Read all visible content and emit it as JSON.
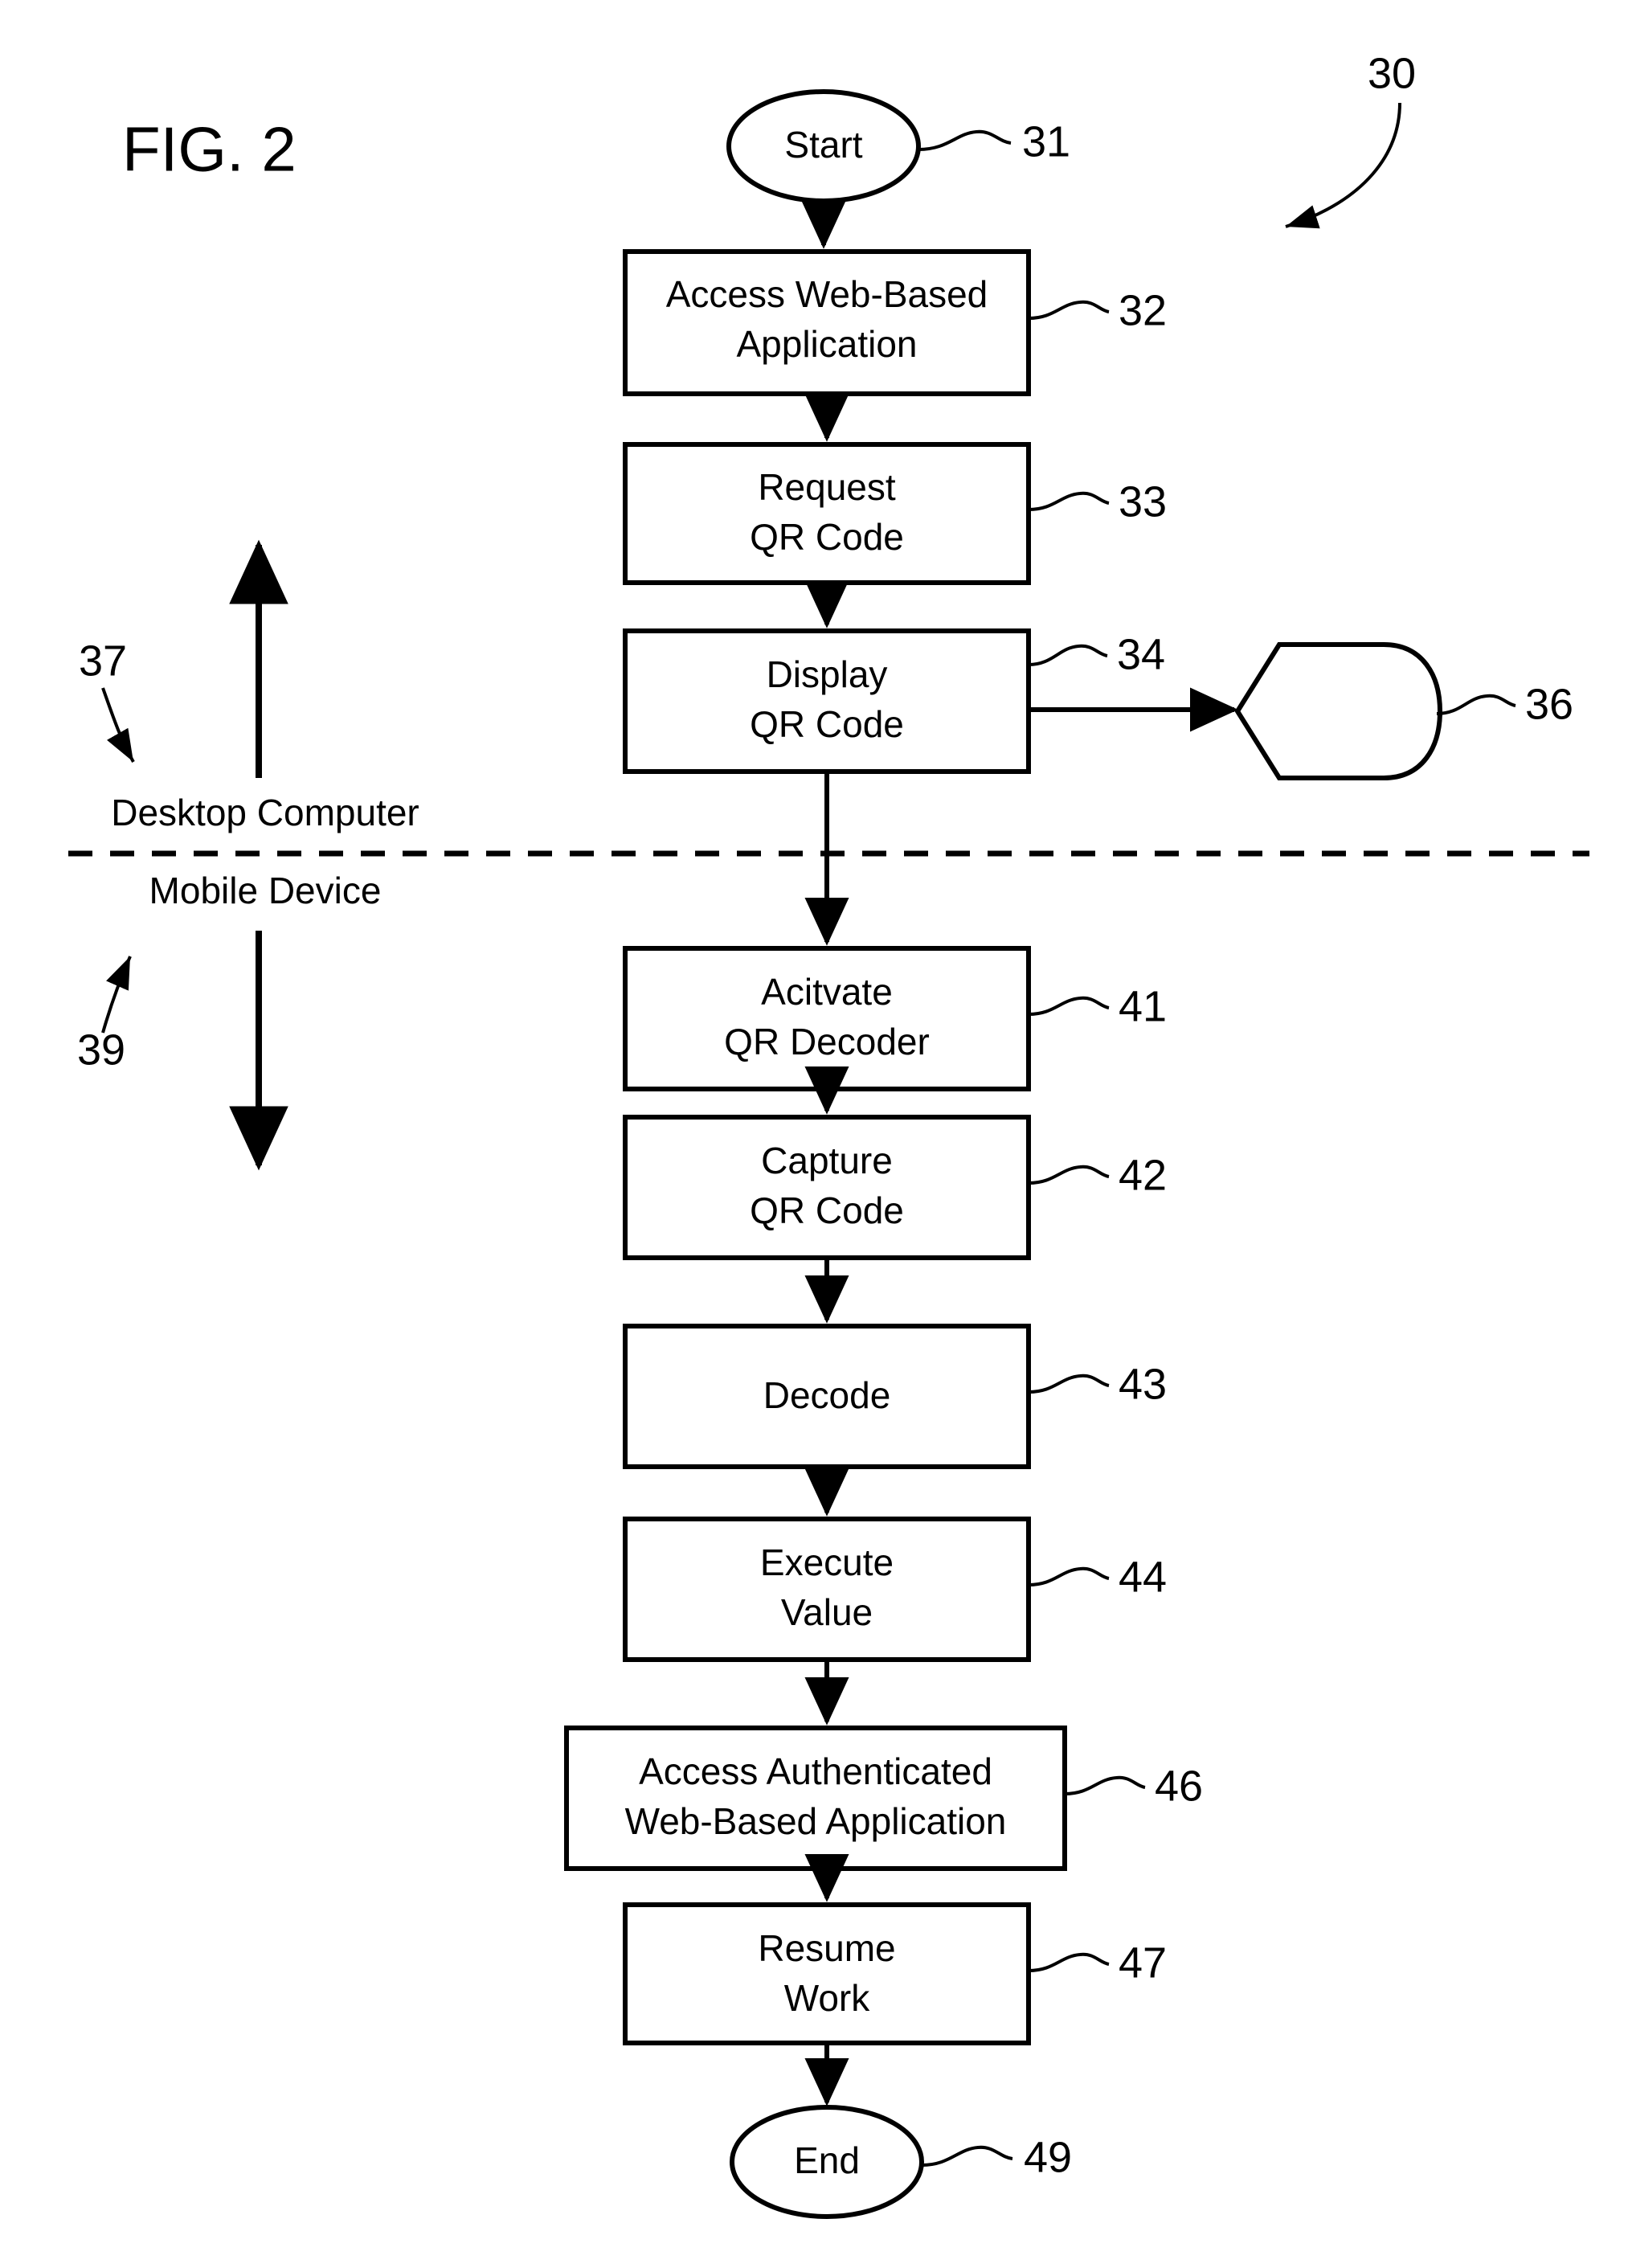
{
  "figure": {
    "title": "FIG. 2",
    "overall_ref": "30"
  },
  "lanes": {
    "top_label": "Desktop Computer",
    "top_ref": "37",
    "bottom_label": "Mobile Device",
    "bottom_ref": "39"
  },
  "nodes": [
    {
      "id": "start",
      "shape": "ellipse",
      "lines": [
        "Start"
      ],
      "ref": "31"
    },
    {
      "id": "n32",
      "shape": "process",
      "lines": [
        "Access Web-Based",
        "Application"
      ],
      "ref": "32"
    },
    {
      "id": "n33",
      "shape": "process",
      "lines": [
        "Request",
        "QR Code"
      ],
      "ref": "33"
    },
    {
      "id": "n34",
      "shape": "process",
      "lines": [
        "Display",
        "QR Code"
      ],
      "ref": "34"
    },
    {
      "id": "n36",
      "shape": "display",
      "lines": [],
      "ref": "36"
    },
    {
      "id": "n41",
      "shape": "process",
      "lines": [
        "Acitvate",
        "QR Decoder"
      ],
      "ref": "41"
    },
    {
      "id": "n42",
      "shape": "process",
      "lines": [
        "Capture",
        "QR Code"
      ],
      "ref": "42"
    },
    {
      "id": "n43",
      "shape": "process",
      "lines": [
        "Decode"
      ],
      "ref": "43"
    },
    {
      "id": "n44",
      "shape": "process",
      "lines": [
        "Execute",
        "Value"
      ],
      "ref": "44"
    },
    {
      "id": "n46",
      "shape": "process",
      "lines": [
        "Access Authenticated",
        "Web-Based Application"
      ],
      "ref": "46"
    },
    {
      "id": "n47",
      "shape": "process",
      "lines": [
        "Resume",
        "Work"
      ],
      "ref": "47"
    },
    {
      "id": "end",
      "shape": "ellipse",
      "lines": [
        "End"
      ],
      "ref": "49"
    }
  ],
  "text": {
    "start_label": "Start",
    "end_label": "End",
    "n32_l1": "Access Web-Based",
    "n32_l2": "Application",
    "n33_l1": "Request",
    "n33_l2": "QR Code",
    "n34_l1": "Display",
    "n34_l2": "QR Code",
    "n41_l1": "Acitvate",
    "n41_l2": "QR Decoder",
    "n42_l1": "Capture",
    "n42_l2": "QR Code",
    "n43_l1": "Decode",
    "n44_l1": "Execute",
    "n44_l2": "Value",
    "n46_l1": "Access Authenticated",
    "n46_l2": "Web-Based Application",
    "n47_l1": "Resume",
    "n47_l2": "Work"
  },
  "refs": {
    "r30": "30",
    "r31": "31",
    "r32": "32",
    "r33": "33",
    "r34": "34",
    "r36": "36",
    "r37": "37",
    "r39": "39",
    "r41": "41",
    "r42": "42",
    "r43": "43",
    "r44": "44",
    "r46": "46",
    "r47": "47",
    "r49": "49"
  },
  "colors": {
    "ink": "#000000",
    "paper": "#ffffff"
  }
}
